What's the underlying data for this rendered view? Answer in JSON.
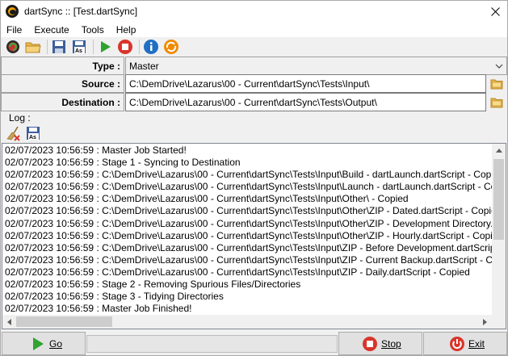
{
  "window": {
    "title": "dartSync :: [Test.dartSync]"
  },
  "menu": {
    "items": [
      "File",
      "Execute",
      "Tools",
      "Help"
    ]
  },
  "toolbar": {
    "buttons": [
      "new-job-icon",
      "open-folder-icon",
      "save-icon",
      "save-as-icon",
      "run-icon",
      "stop-icon",
      "info-icon",
      "sync-icon"
    ]
  },
  "form": {
    "type_label": "Type :",
    "type_value": "Master",
    "source_label": "Source :",
    "source_value": "C:\\DemDrive\\Lazarus\\00 - Current\\dartSync\\Tests\\Input\\",
    "destination_label": "Destination :",
    "destination_value": "C:\\DemDrive\\Lazarus\\00 - Current\\dartSync\\Tests\\Output\\"
  },
  "log": {
    "label": "Log :",
    "lines": [
      "02/07/2023 10:56:59 : Master Job Started!",
      "02/07/2023 10:56:59 : Stage 1 - Syncing to Destination",
      "02/07/2023 10:56:59 : C:\\DemDrive\\Lazarus\\00 - Current\\dartSync\\Tests\\Input\\Build - dartLaunch.dartScript - Copied",
      "02/07/2023 10:56:59 : C:\\DemDrive\\Lazarus\\00 - Current\\dartSync\\Tests\\Input\\Launch - dartLaunch.dartScript - Copied",
      "02/07/2023 10:56:59 : C:\\DemDrive\\Lazarus\\00 - Current\\dartSync\\Tests\\Input\\Other\\ - Copied",
      "02/07/2023 10:56:59 : C:\\DemDrive\\Lazarus\\00 - Current\\dartSync\\Tests\\Input\\Other\\ZIP - Dated.dartScript - Copied",
      "02/07/2023 10:56:59 : C:\\DemDrive\\Lazarus\\00 - Current\\dartSync\\Tests\\Input\\Other\\ZIP - Development Directory.dartScript",
      "02/07/2023 10:56:59 : C:\\DemDrive\\Lazarus\\00 - Current\\dartSync\\Tests\\Input\\Other\\ZIP - Hourly.dartScript - Copied",
      "02/07/2023 10:56:59 : C:\\DemDrive\\Lazarus\\00 - Current\\dartSync\\Tests\\Input\\ZIP - Before Development.dartScript - Copied",
      "02/07/2023 10:56:59 : C:\\DemDrive\\Lazarus\\00 - Current\\dartSync\\Tests\\Input\\ZIP - Current Backup.dartScript - Copied",
      "02/07/2023 10:56:59 : C:\\DemDrive\\Lazarus\\00 - Current\\dartSync\\Tests\\Input\\ZIP - Daily.dartScript - Copied",
      "02/07/2023 10:56:59 : Stage 2 - Removing Spurious Files/Directories",
      "02/07/2023 10:56:59 : Stage 3 - Tidying Directories",
      "02/07/2023 10:56:59 : Master Job Finished!"
    ]
  },
  "bottom": {
    "go_label": "Go",
    "stop_label": "Stop",
    "exit_label": "Exit"
  }
}
